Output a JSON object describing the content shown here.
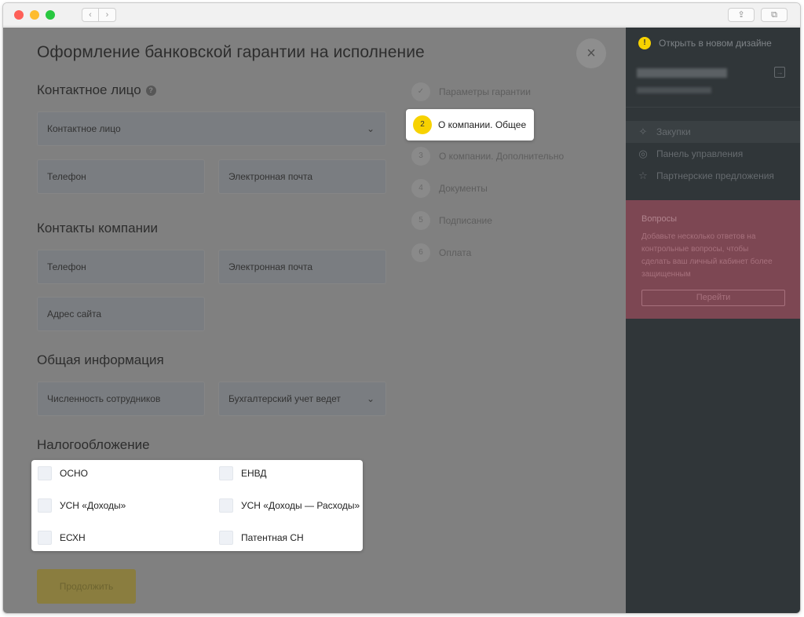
{
  "window": {
    "nav_back": "‹",
    "nav_forward": "›",
    "share_icon": "⇪",
    "tabs_icon": "⧉"
  },
  "page": {
    "title": "Оформление банковской гарантии на исполнение",
    "close_symbol": "×"
  },
  "contact_person": {
    "title": "Контактное лицо",
    "help_symbol": "?",
    "select_placeholder": "Контактное лицо",
    "phone_placeholder": "Телефон",
    "email_placeholder": "Электронная почта"
  },
  "company_contacts": {
    "title": "Контакты компании",
    "phone_placeholder": "Телефон",
    "email_placeholder": "Электронная почта",
    "site_placeholder": "Адрес сайта"
  },
  "general_info": {
    "title": "Общая информация",
    "employees_placeholder": "Численность сотрудников",
    "accounting_placeholder": "Бухгалтерский учет ведет"
  },
  "taxation": {
    "title": "Налогообложение",
    "options": [
      "ОСНО",
      "ЕНВД",
      "УСН «Доходы»",
      "УСН «Доходы — Расходы»",
      "ЕСХН",
      "Патентная СН"
    ]
  },
  "steps": [
    {
      "num": "✓",
      "label": "Параметры гарантии"
    },
    {
      "num": "2",
      "label": "О компании. Общее"
    },
    {
      "num": "3",
      "label": "О компании. Дополнительно"
    },
    {
      "num": "4",
      "label": "Документы"
    },
    {
      "num": "5",
      "label": "Подписание"
    },
    {
      "num": "6",
      "label": "Оплата"
    }
  ],
  "continue_label": "Продолжить",
  "sidebar": {
    "new_design": "Открыть в новом дизайне",
    "warn_symbol": "!",
    "logout_symbol": "→",
    "items": [
      {
        "label": "Закупки",
        "icon": "✧"
      },
      {
        "label": "Панель управления",
        "icon": "◎"
      },
      {
        "label": "Партнерские предложения",
        "icon": "☆"
      }
    ],
    "questions": {
      "title": "Вопросы",
      "text": "Добавьте несколько ответов на контрольные вопросы, чтобы сделать ваш личный кабинет более защищенным",
      "button": "Перейти"
    }
  },
  "colors": {
    "accent_yellow": "#f7d200",
    "sidebar_bg": "#303639",
    "questions_bg": "#7d4753"
  }
}
